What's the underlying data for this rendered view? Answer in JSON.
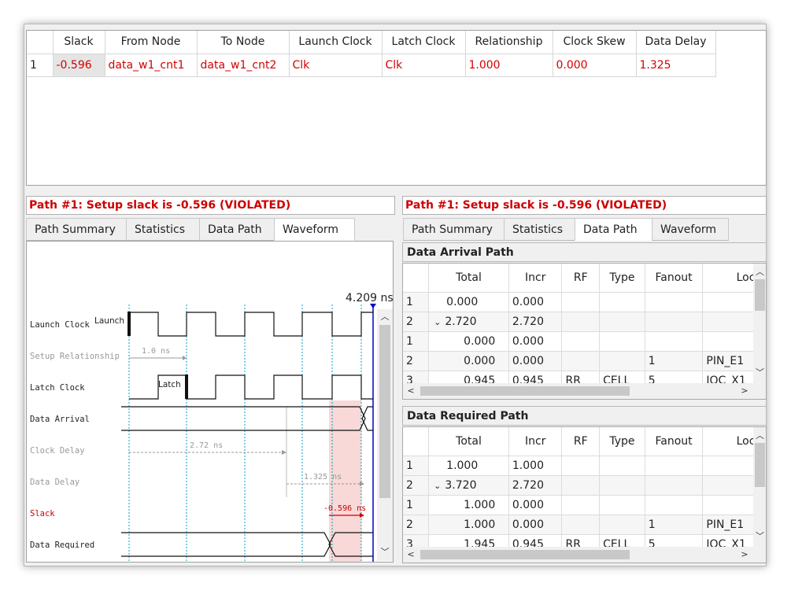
{
  "summary_table": {
    "headers": [
      "",
      "Slack",
      "From Node",
      "To Node",
      "Launch Clock",
      "Latch Clock",
      "Relationship",
      "Clock Skew",
      "Data Delay"
    ],
    "rows": [
      [
        "1",
        "-0.596",
        "data_w1_cnt1",
        "data_w1_cnt2",
        "Clk",
        "Clk",
        "1.000",
        "0.000",
        "1.325"
      ]
    ]
  },
  "left_pane": {
    "header": "Path #1: Setup slack is -0.596 (VIOLATED)",
    "tabs": [
      "Path Summary",
      "Statistics",
      "Data Path",
      "Waveform"
    ],
    "active_tab": "Waveform"
  },
  "right_pane": {
    "header": "Path #1: Setup slack is -0.596 (VIOLATED)",
    "tabs": [
      "Path Summary",
      "Statistics",
      "Data Path",
      "Waveform"
    ],
    "active_tab": "Data Path"
  },
  "waveform": {
    "end_time": "4.209 ns",
    "signals": [
      "Launch Clock",
      "Setup Relationship",
      "Latch Clock",
      "Data Arrival",
      "Clock Delay",
      "Data Delay",
      "Slack",
      "Data Required"
    ],
    "launch_marker": "Launch",
    "latch_marker": "Latch",
    "setup_label": "1.0 ns",
    "clock_delay_label": "2.72 ns",
    "data_delay_label": "1.325 ns",
    "slack_label": "-0.596 ns"
  },
  "arrival_path": {
    "title": "Data Arrival Path",
    "headers": [
      "",
      "Total",
      "Incr",
      "RF",
      "Type",
      "Fanout",
      "Loca"
    ],
    "rows": [
      [
        "1",
        "0.000",
        "0.000",
        "",
        "",
        "",
        ""
      ],
      [
        "2",
        "2.720",
        "2.720",
        "",
        "",
        "",
        ""
      ],
      [
        "1",
        "0.000",
        "0.000",
        "",
        "",
        "",
        ""
      ],
      [
        "2",
        "0.000",
        "0.000",
        "",
        "",
        "1",
        "PIN_E1"
      ],
      [
        "3",
        "0.945",
        "0.945",
        "RR",
        "CELL",
        "5",
        "IOC_X1"
      ]
    ]
  },
  "required_path": {
    "title": "Data Required Path",
    "headers": [
      "",
      "Total",
      "Incr",
      "RF",
      "Type",
      "Fanout",
      "Loca"
    ],
    "rows": [
      [
        "1",
        "1.000",
        "1.000",
        "",
        "",
        "",
        ""
      ],
      [
        "2",
        "3.720",
        "2.720",
        "",
        "",
        "",
        ""
      ],
      [
        "1",
        "1.000",
        "0.000",
        "",
        "",
        "",
        ""
      ],
      [
        "2",
        "1.000",
        "0.000",
        "",
        "",
        "1",
        "PIN_E1"
      ],
      [
        "3",
        "1.945",
        "0.945",
        "RR",
        "CELL",
        "5",
        "IOC_X1"
      ]
    ]
  },
  "icons": {
    "expand": "chevron-down-icon",
    "scroll_up": "arrow-up-icon",
    "scroll_down": "arrow-down-icon",
    "scroll_left": "arrow-left-icon",
    "scroll_right": "arrow-right-icon"
  },
  "colors": {
    "violation_red": "#d40000",
    "timeline_blue": "#0000cc",
    "guide_cyan": "#00a0c8",
    "slack_region": "#f9d8d8"
  }
}
